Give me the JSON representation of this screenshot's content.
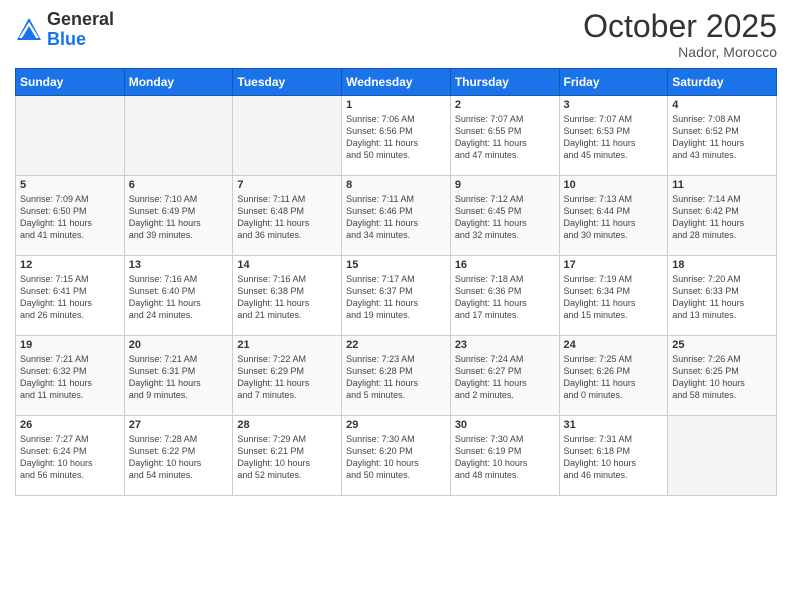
{
  "header": {
    "logo_general": "General",
    "logo_blue": "Blue",
    "month": "October 2025",
    "location": "Nador, Morocco"
  },
  "days_of_week": [
    "Sunday",
    "Monday",
    "Tuesday",
    "Wednesday",
    "Thursday",
    "Friday",
    "Saturday"
  ],
  "weeks": [
    [
      {
        "day": "",
        "info": ""
      },
      {
        "day": "",
        "info": ""
      },
      {
        "day": "",
        "info": ""
      },
      {
        "day": "1",
        "info": "Sunrise: 7:06 AM\nSunset: 6:56 PM\nDaylight: 11 hours\nand 50 minutes."
      },
      {
        "day": "2",
        "info": "Sunrise: 7:07 AM\nSunset: 6:55 PM\nDaylight: 11 hours\nand 47 minutes."
      },
      {
        "day": "3",
        "info": "Sunrise: 7:07 AM\nSunset: 6:53 PM\nDaylight: 11 hours\nand 45 minutes."
      },
      {
        "day": "4",
        "info": "Sunrise: 7:08 AM\nSunset: 6:52 PM\nDaylight: 11 hours\nand 43 minutes."
      }
    ],
    [
      {
        "day": "5",
        "info": "Sunrise: 7:09 AM\nSunset: 6:50 PM\nDaylight: 11 hours\nand 41 minutes."
      },
      {
        "day": "6",
        "info": "Sunrise: 7:10 AM\nSunset: 6:49 PM\nDaylight: 11 hours\nand 39 minutes."
      },
      {
        "day": "7",
        "info": "Sunrise: 7:11 AM\nSunset: 6:48 PM\nDaylight: 11 hours\nand 36 minutes."
      },
      {
        "day": "8",
        "info": "Sunrise: 7:11 AM\nSunset: 6:46 PM\nDaylight: 11 hours\nand 34 minutes."
      },
      {
        "day": "9",
        "info": "Sunrise: 7:12 AM\nSunset: 6:45 PM\nDaylight: 11 hours\nand 32 minutes."
      },
      {
        "day": "10",
        "info": "Sunrise: 7:13 AM\nSunset: 6:44 PM\nDaylight: 11 hours\nand 30 minutes."
      },
      {
        "day": "11",
        "info": "Sunrise: 7:14 AM\nSunset: 6:42 PM\nDaylight: 11 hours\nand 28 minutes."
      }
    ],
    [
      {
        "day": "12",
        "info": "Sunrise: 7:15 AM\nSunset: 6:41 PM\nDaylight: 11 hours\nand 26 minutes."
      },
      {
        "day": "13",
        "info": "Sunrise: 7:16 AM\nSunset: 6:40 PM\nDaylight: 11 hours\nand 24 minutes."
      },
      {
        "day": "14",
        "info": "Sunrise: 7:16 AM\nSunset: 6:38 PM\nDaylight: 11 hours\nand 21 minutes."
      },
      {
        "day": "15",
        "info": "Sunrise: 7:17 AM\nSunset: 6:37 PM\nDaylight: 11 hours\nand 19 minutes."
      },
      {
        "day": "16",
        "info": "Sunrise: 7:18 AM\nSunset: 6:36 PM\nDaylight: 11 hours\nand 17 minutes."
      },
      {
        "day": "17",
        "info": "Sunrise: 7:19 AM\nSunset: 6:34 PM\nDaylight: 11 hours\nand 15 minutes."
      },
      {
        "day": "18",
        "info": "Sunrise: 7:20 AM\nSunset: 6:33 PM\nDaylight: 11 hours\nand 13 minutes."
      }
    ],
    [
      {
        "day": "19",
        "info": "Sunrise: 7:21 AM\nSunset: 6:32 PM\nDaylight: 11 hours\nand 11 minutes."
      },
      {
        "day": "20",
        "info": "Sunrise: 7:21 AM\nSunset: 6:31 PM\nDaylight: 11 hours\nand 9 minutes."
      },
      {
        "day": "21",
        "info": "Sunrise: 7:22 AM\nSunset: 6:29 PM\nDaylight: 11 hours\nand 7 minutes."
      },
      {
        "day": "22",
        "info": "Sunrise: 7:23 AM\nSunset: 6:28 PM\nDaylight: 11 hours\nand 5 minutes."
      },
      {
        "day": "23",
        "info": "Sunrise: 7:24 AM\nSunset: 6:27 PM\nDaylight: 11 hours\nand 2 minutes."
      },
      {
        "day": "24",
        "info": "Sunrise: 7:25 AM\nSunset: 6:26 PM\nDaylight: 11 hours\nand 0 minutes."
      },
      {
        "day": "25",
        "info": "Sunrise: 7:26 AM\nSunset: 6:25 PM\nDaylight: 10 hours\nand 58 minutes."
      }
    ],
    [
      {
        "day": "26",
        "info": "Sunrise: 7:27 AM\nSunset: 6:24 PM\nDaylight: 10 hours\nand 56 minutes."
      },
      {
        "day": "27",
        "info": "Sunrise: 7:28 AM\nSunset: 6:22 PM\nDaylight: 10 hours\nand 54 minutes."
      },
      {
        "day": "28",
        "info": "Sunrise: 7:29 AM\nSunset: 6:21 PM\nDaylight: 10 hours\nand 52 minutes."
      },
      {
        "day": "29",
        "info": "Sunrise: 7:30 AM\nSunset: 6:20 PM\nDaylight: 10 hours\nand 50 minutes."
      },
      {
        "day": "30",
        "info": "Sunrise: 7:30 AM\nSunset: 6:19 PM\nDaylight: 10 hours\nand 48 minutes."
      },
      {
        "day": "31",
        "info": "Sunrise: 7:31 AM\nSunset: 6:18 PM\nDaylight: 10 hours\nand 46 minutes."
      },
      {
        "day": "",
        "info": ""
      }
    ]
  ]
}
